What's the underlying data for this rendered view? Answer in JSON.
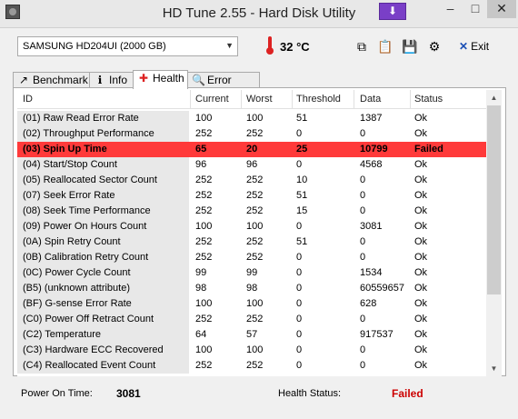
{
  "window": {
    "title": "HD Tune 2.55 - Hard Disk Utility",
    "min": "–",
    "max": "□",
    "close": "✕",
    "drop_icon": "⬇"
  },
  "toolbar": {
    "drive": "SAMSUNG HD204UI (2000 GB)",
    "temperature": "32 °C",
    "exit_label": "Exit",
    "exit_mnemonic": "✕",
    "tools": [
      "copy-icon",
      "clipboard-icon",
      "save-icon",
      "options-icon"
    ],
    "tool_glyphs": [
      "⧉",
      "📋",
      "💾",
      "⚙"
    ]
  },
  "tabs": [
    {
      "label": "Benchmark",
      "icon": "benchmark-icon",
      "glyph": "↗"
    },
    {
      "label": "Info",
      "icon": "info-icon",
      "glyph": "ℹ"
    },
    {
      "label": "Health",
      "icon": "health-icon",
      "glyph": "✚"
    },
    {
      "label": "Error Scan",
      "icon": "search-icon",
      "glyph": "🔍"
    }
  ],
  "table": {
    "columns": [
      "ID",
      "Current",
      "Worst",
      "Threshold",
      "Data",
      "Status"
    ],
    "rows": [
      [
        "(01) Raw Read Error Rate",
        "100",
        "100",
        "51",
        "1387",
        "Ok"
      ],
      [
        "(02) Throughput Performance",
        "252",
        "252",
        "0",
        "0",
        "Ok"
      ],
      [
        "(03) Spin Up Time",
        "65",
        "20",
        "25",
        "10799",
        "Failed"
      ],
      [
        "(04) Start/Stop Count",
        "96",
        "96",
        "0",
        "4568",
        "Ok"
      ],
      [
        "(05) Reallocated Sector Count",
        "252",
        "252",
        "10",
        "0",
        "Ok"
      ],
      [
        "(07) Seek Error Rate",
        "252",
        "252",
        "51",
        "0",
        "Ok"
      ],
      [
        "(08) Seek Time Performance",
        "252",
        "252",
        "15",
        "0",
        "Ok"
      ],
      [
        "(09) Power On Hours Count",
        "100",
        "100",
        "0",
        "3081",
        "Ok"
      ],
      [
        "(0A) Spin Retry Count",
        "252",
        "252",
        "51",
        "0",
        "Ok"
      ],
      [
        "(0B) Calibration Retry Count",
        "252",
        "252",
        "0",
        "0",
        "Ok"
      ],
      [
        "(0C) Power Cycle Count",
        "99",
        "99",
        "0",
        "1534",
        "Ok"
      ],
      [
        "(B5) (unknown attribute)",
        "98",
        "98",
        "0",
        "60559657",
        "Ok"
      ],
      [
        "(BF) G-sense Error Rate",
        "100",
        "100",
        "0",
        "628",
        "Ok"
      ],
      [
        "(C0) Power Off Retract Count",
        "252",
        "252",
        "0",
        "0",
        "Ok"
      ],
      [
        "(C2) Temperature",
        "64",
        "57",
        "0",
        "917537",
        "Ok"
      ],
      [
        "(C3) Hardware ECC Recovered",
        "100",
        "100",
        "0",
        "0",
        "Ok"
      ],
      [
        "(C4) Reallocated Event Count",
        "252",
        "252",
        "0",
        "0",
        "Ok"
      ]
    ],
    "failed_row_color": "#ff3a3a"
  },
  "status": {
    "power_on_label": "Power On Time:",
    "power_on_value": "3081",
    "health_label": "Health Status:",
    "health_value": "Failed",
    "health_color": "#cc0000"
  }
}
